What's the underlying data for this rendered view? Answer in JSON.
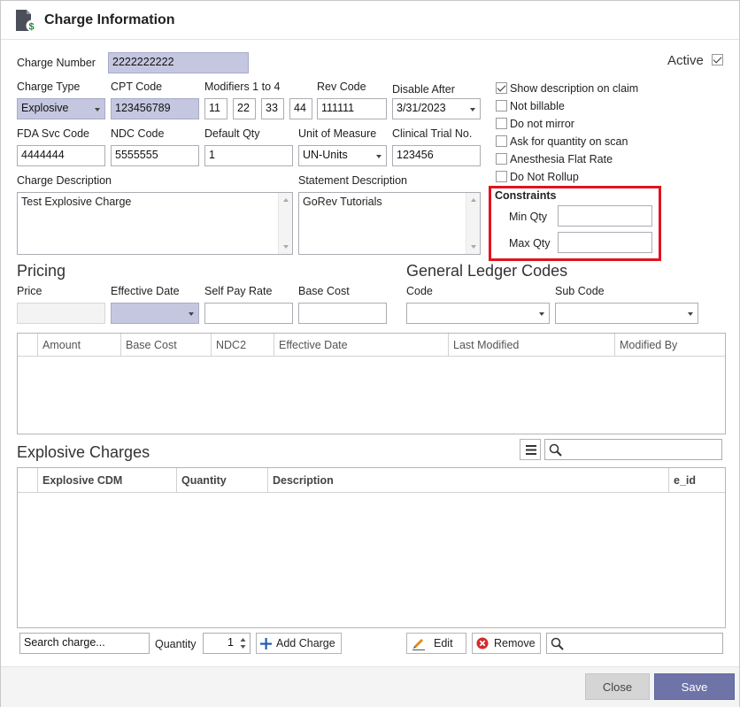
{
  "window": {
    "title": "Charge Information"
  },
  "header": {
    "active_label": "Active",
    "active_checked": true
  },
  "charge_number": {
    "label": "Charge Number",
    "value": "2222222222"
  },
  "charge_type": {
    "label": "Charge Type",
    "value": "Explosive"
  },
  "cpt_code": {
    "label": "CPT Code",
    "value": "123456789"
  },
  "modifiers": {
    "label": "Modifiers 1 to 4",
    "values": [
      "11",
      "22",
      "33",
      "44"
    ]
  },
  "rev_code": {
    "label": "Rev Code",
    "value": "111111"
  },
  "disable_after": {
    "label": "Disable After",
    "value": "3/31/2023"
  },
  "fda_svc_code": {
    "label": "FDA Svc Code",
    "value": "4444444"
  },
  "ndc_code": {
    "label": "NDC Code",
    "value": "5555555"
  },
  "default_qty": {
    "label": "Default Qty",
    "value": "1"
  },
  "unit_of_measure": {
    "label": "Unit of Measure",
    "value": "UN-Units"
  },
  "clinical_trial": {
    "label": "Clinical Trial No.",
    "value": "123456"
  },
  "charge_description": {
    "label": "Charge Description",
    "value": "Test Explosive Charge"
  },
  "statement_description": {
    "label": "Statement Description",
    "value": "GoRev Tutorials"
  },
  "options": [
    {
      "label": "Show description on claim",
      "checked": true
    },
    {
      "label": "Not billable",
      "checked": false
    },
    {
      "label": "Do not mirror",
      "checked": false
    },
    {
      "label": "Ask for quantity on scan",
      "checked": false
    },
    {
      "label": "Anesthesia Flat Rate",
      "checked": false
    },
    {
      "label": "Do Not Rollup",
      "checked": false
    }
  ],
  "constraints": {
    "title": "Constraints",
    "min_label": "Min Qty",
    "min_value": "",
    "max_label": "Max Qty",
    "max_value": ""
  },
  "pricing": {
    "title": "Pricing",
    "price_label": "Price",
    "price_value": "",
    "effective_label": "Effective Date",
    "effective_value": "",
    "selfpay_label": "Self Pay Rate",
    "selfpay_value": "",
    "basecost_label": "Base Cost",
    "basecost_value": "",
    "columns": [
      "Amount",
      "Base Cost",
      "NDC2",
      "Effective Date",
      "Last Modified",
      "Modified By"
    ]
  },
  "gl_codes": {
    "title": "General Ledger Codes",
    "code_label": "Code",
    "code_value": "",
    "subcode_label": "Sub Code",
    "subcode_value": ""
  },
  "explosive": {
    "title": "Explosive Charges",
    "columns": [
      "Explosive CDM",
      "Quantity",
      "Description",
      "e_id"
    ],
    "search_value": ""
  },
  "bottom_bar": {
    "search_placeholder": "Search charge...",
    "quantity_label": "Quantity",
    "quantity_value": "1",
    "add_label": "Add Charge",
    "edit_label": "Edit",
    "remove_label": "Remove",
    "search_value": ""
  },
  "footer": {
    "close_label": "Close",
    "save_label": "Save"
  },
  "colors": {
    "highlight": "#c5c7e0",
    "save_button": "#6f74a8",
    "close_button": "#d5d5d5",
    "constraint_border": "#e0141e"
  }
}
